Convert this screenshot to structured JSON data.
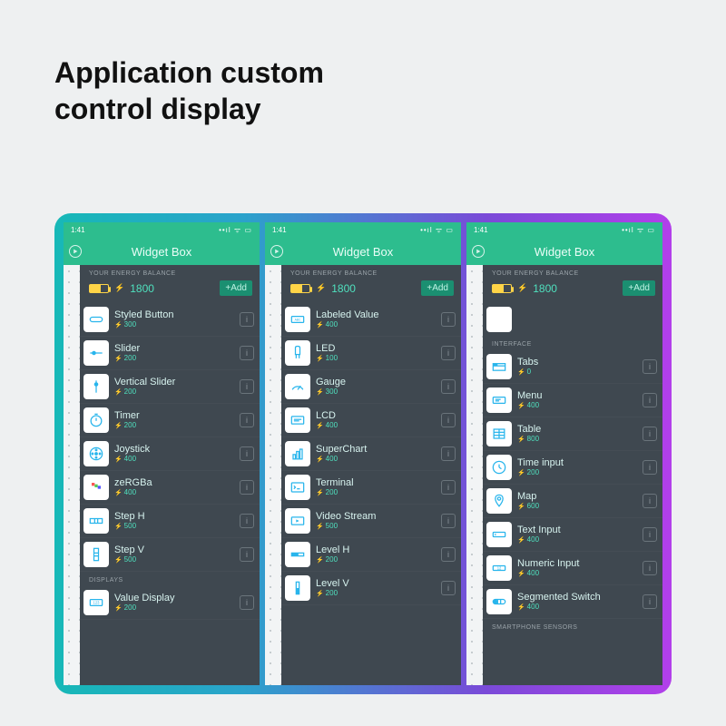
{
  "title_line1": "Application custom",
  "title_line2": "control display",
  "statusbar_time": "1:41",
  "topbar_title": "Widget Box",
  "balance_label": "YOUR ENERGY BALANCE",
  "balance_amount": "1800",
  "add_button_label": "+Add",
  "info_glyph": "i",
  "screens": [
    {
      "section_top": "",
      "section_bottom": "DISPLAYS",
      "widgets": [
        {
          "name": "Styled Button",
          "cost": "300",
          "icon": "button"
        },
        {
          "name": "Slider",
          "cost": "200",
          "icon": "slider"
        },
        {
          "name": "Vertical Slider",
          "cost": "200",
          "icon": "vslider"
        },
        {
          "name": "Timer",
          "cost": "200",
          "icon": "timer"
        },
        {
          "name": "Joystick",
          "cost": "400",
          "icon": "joystick"
        },
        {
          "name": "zeRGBa",
          "cost": "400",
          "icon": "zergba"
        },
        {
          "name": "Step H",
          "cost": "500",
          "icon": "steph"
        },
        {
          "name": "Step V",
          "cost": "500",
          "icon": "stepv"
        }
      ],
      "widgets_after": [
        {
          "name": "Value Display",
          "cost": "200",
          "icon": "value"
        }
      ]
    },
    {
      "section_top": "",
      "section_bottom": "",
      "widgets": [
        {
          "name": "Labeled Value",
          "cost": "400",
          "icon": "labeled"
        },
        {
          "name": "LED",
          "cost": "100",
          "icon": "led"
        },
        {
          "name": "Gauge",
          "cost": "300",
          "icon": "gauge"
        },
        {
          "name": "LCD",
          "cost": "400",
          "icon": "lcd"
        },
        {
          "name": "SuperChart",
          "cost": "400",
          "icon": "chart"
        },
        {
          "name": "Terminal",
          "cost": "200",
          "icon": "terminal"
        },
        {
          "name": "Video Stream",
          "cost": "500",
          "icon": "video"
        },
        {
          "name": "Level H",
          "cost": "200",
          "icon": "levelh"
        },
        {
          "name": "Level V",
          "cost": "200",
          "icon": "levelv"
        }
      ],
      "widgets_after": []
    },
    {
      "section_top": "INTERFACE",
      "section_bottom": "SMARTPHONE SENSORS",
      "widgets": [
        {
          "name": "Tabs",
          "cost": "0",
          "icon": "tabs"
        },
        {
          "name": "Menu",
          "cost": "400",
          "icon": "menu"
        },
        {
          "name": "Table",
          "cost": "800",
          "icon": "table"
        },
        {
          "name": "Time input",
          "cost": "200",
          "icon": "timeinput"
        },
        {
          "name": "Map",
          "cost": "600",
          "icon": "map"
        },
        {
          "name": "Text Input",
          "cost": "400",
          "icon": "textinput"
        },
        {
          "name": "Numeric Input",
          "cost": "400",
          "icon": "numeric"
        },
        {
          "name": "Segmented Switch",
          "cost": "400",
          "icon": "segmented"
        }
      ],
      "widgets_after": []
    }
  ]
}
